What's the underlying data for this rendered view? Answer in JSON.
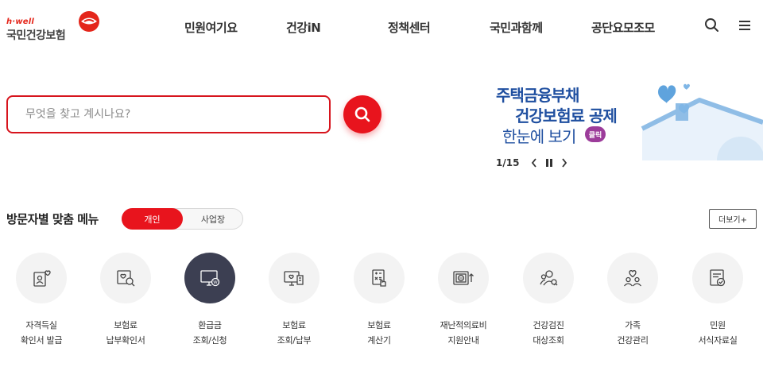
{
  "header": {
    "logo_small": "h·well",
    "logo_name": "국민건강보험",
    "nav": [
      "민원여기요",
      "건강iN",
      "정책센터",
      "국민과함께",
      "공단요모조모"
    ]
  },
  "search": {
    "placeholder": "무엇을 찾고 계시나요?"
  },
  "banner": {
    "line1": "주택금융부채",
    "line2": "건강보험료 공제",
    "line3": "한눈에 보기",
    "click_badge": "클릭",
    "pager": "1/15"
  },
  "section": {
    "title": "방문자별 맞춤 메뉴",
    "toggle_on": "개인",
    "toggle_off": "사업장",
    "more": "더보기+"
  },
  "quick_menu": [
    {
      "label": "자격득실\n확인서 발급",
      "icon": "person-card-icon"
    },
    {
      "label": "보험료\n납부확인서",
      "icon": "document-search-icon"
    },
    {
      "label": "환급금\n조회/신청",
      "icon": "monitor-won-icon"
    },
    {
      "label": "보험료\n조회/납부",
      "icon": "monitor-receipt-icon"
    },
    {
      "label": "보험료\n계산기",
      "icon": "calculator-icon"
    },
    {
      "label": "재난적의료비\n지원안내",
      "icon": "won-support-icon"
    },
    {
      "label": "건강검진\n대상조회",
      "icon": "people-search-icon"
    },
    {
      "label": "가족\n건강관리",
      "icon": "family-heart-icon"
    },
    {
      "label": "민원\n서식자료실",
      "icon": "form-check-icon"
    }
  ],
  "colors": {
    "brand_red": "#e8141d",
    "banner_blue": "#1f4fa0",
    "active_icon_bg": "#3c3f52"
  }
}
